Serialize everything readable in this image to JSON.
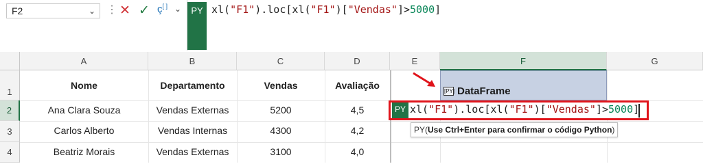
{
  "name_box": {
    "value": "F2"
  },
  "formula_bar": {
    "badge": "PY",
    "formula_parts": [
      {
        "t": "xl(",
        "k": "fn"
      },
      {
        "t": "\"F1\"",
        "k": "str"
      },
      {
        "t": ").loc[xl(",
        "k": "fn"
      },
      {
        "t": "\"F1\"",
        "k": "str"
      },
      {
        "t": ")[",
        "k": "fn"
      },
      {
        "t": "\"Vendas\"",
        "k": "str"
      },
      {
        "t": "]>",
        "k": "fn"
      },
      {
        "t": "5000",
        "k": "num"
      },
      {
        "t": "]",
        "k": "fn"
      }
    ]
  },
  "columns": [
    "A",
    "B",
    "C",
    "D",
    "E",
    "F",
    "G"
  ],
  "rows": [
    "1",
    "2",
    "3",
    "4"
  ],
  "table": {
    "headers": [
      "Nome",
      "Departamento",
      "Vendas",
      "Avaliação"
    ],
    "rows": [
      [
        "Ana Clara Souza",
        "Vendas Externas",
        "5200",
        "4,5"
      ],
      [
        "Carlos Alberto",
        "Vendas Internas",
        "4300",
        "4,2"
      ],
      [
        "Beatriz Morais",
        "Vendas Externas",
        "3100",
        "4,0"
      ]
    ]
  },
  "f1_cell": {
    "icon": "[PY]",
    "label": "DataFrame"
  },
  "edit_cell": {
    "badge": "PY",
    "formula_parts": [
      {
        "t": "xl(",
        "k": "fn"
      },
      {
        "t": "\"F1\"",
        "k": "str"
      },
      {
        "t": ").loc[xl(",
        "k": "fn"
      },
      {
        "t": "\"F1\"",
        "k": "str"
      },
      {
        "t": ")[",
        "k": "fn"
      },
      {
        "t": "\"Vendas\"",
        "k": "str"
      },
      {
        "t": "]>",
        "k": "fn"
      },
      {
        "t": "5000",
        "k": "num"
      },
      {
        "t": "]",
        "k": "fn"
      }
    ]
  },
  "tooltip": {
    "prefix": "PY(",
    "bold": "Use Ctrl+Enter para confirmar o código Python",
    "suffix": ")"
  },
  "colors": {
    "accent_green": "#217346",
    "highlight_red": "#e0141b",
    "selection": "#c7d1e3"
  }
}
